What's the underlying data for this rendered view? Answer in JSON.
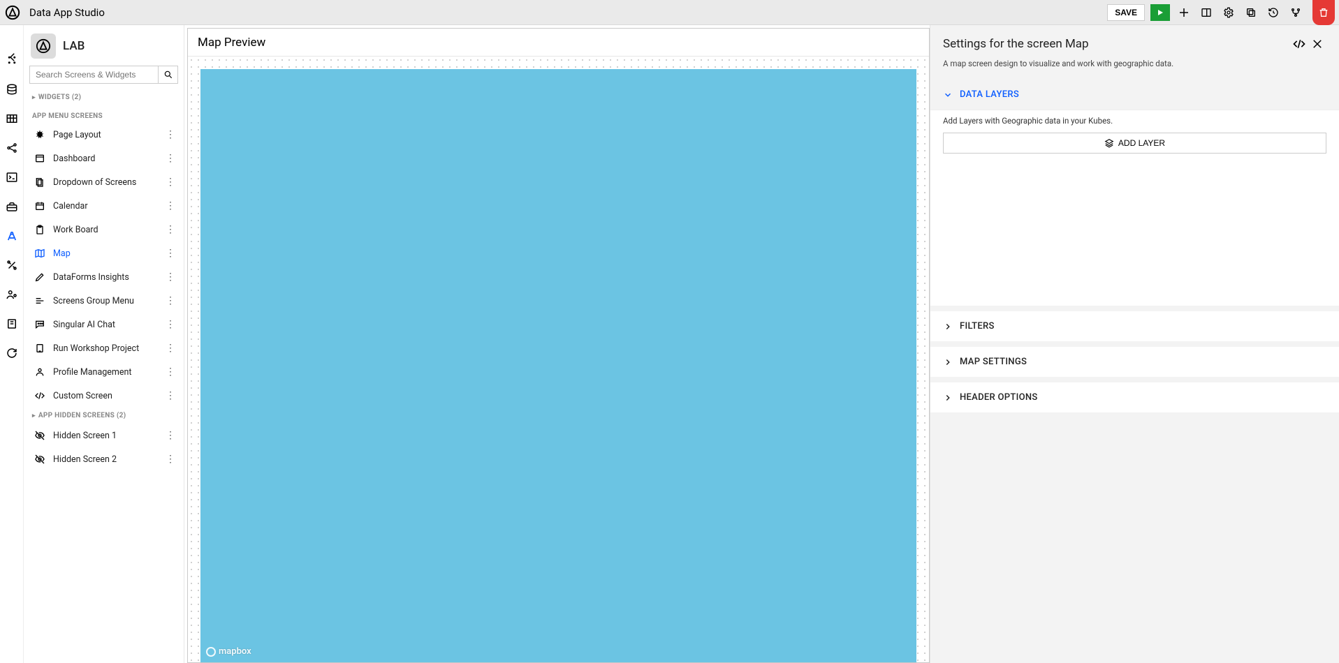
{
  "header": {
    "title": "Data App Studio",
    "save_label": "SAVE"
  },
  "sidebar": {
    "app_name": "LAB",
    "search_placeholder": "Search Screens & Widgets",
    "widgets_label": "WIDGETS (2)",
    "menu_section_label": "APP MENU SCREENS",
    "hidden_section_label": "APP HIDDEN SCREENS (2)",
    "screens": [
      {
        "label": "Page Layout",
        "icon": "burst"
      },
      {
        "label": "Dashboard",
        "icon": "window"
      },
      {
        "label": "Dropdown of Screens",
        "icon": "stacks"
      },
      {
        "label": "Calendar",
        "icon": "calendar"
      },
      {
        "label": "Work Board",
        "icon": "clipboard"
      },
      {
        "label": "Map",
        "icon": "map",
        "active": true
      },
      {
        "label": "DataForms Insights",
        "icon": "pencil"
      },
      {
        "label": "Screens Group Menu",
        "icon": "lines"
      },
      {
        "label": "Singular AI Chat",
        "icon": "chat"
      },
      {
        "label": "Run Workshop Project",
        "icon": "tablet"
      },
      {
        "label": "Profile Management",
        "icon": "person"
      },
      {
        "label": "Custom Screen",
        "icon": "code"
      }
    ],
    "hidden_screens": [
      {
        "label": "Hidden Screen 1",
        "icon": "eyeoff"
      },
      {
        "label": "Hidden Screen 2",
        "icon": "eyeoff"
      }
    ]
  },
  "canvas": {
    "preview_title": "Map Preview",
    "map_attribution": "mapbox"
  },
  "settings": {
    "title": "Settings for the screen Map",
    "description": "A map screen design to visualize and work with geographic data.",
    "sections": {
      "data_layers": {
        "title": "DATA LAYERS",
        "helper": "Add Layers with Geographic data in your Kubes.",
        "add_button": "ADD LAYER"
      },
      "filters": {
        "title": "FILTERS"
      },
      "map_settings": {
        "title": "MAP SETTINGS"
      },
      "header_options": {
        "title": "HEADER OPTIONS"
      }
    }
  }
}
